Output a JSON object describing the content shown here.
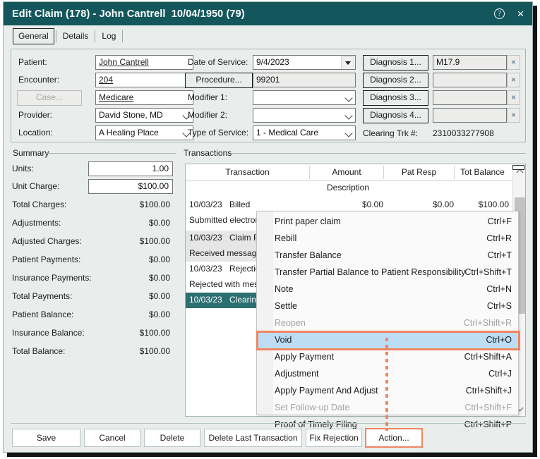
{
  "window": {
    "title": "Edit Claim (178) - John Cantrell  10/04/1950 (79)",
    "help_icon": "?",
    "close_icon": "×",
    "titlebar_color": "#13565c",
    "accent_color": "#f08562",
    "selection_color": "#2c6f70"
  },
  "tabs": [
    {
      "label": "General",
      "active": true
    },
    {
      "label": "Details",
      "active": false
    },
    {
      "label": "Log",
      "active": false
    }
  ],
  "form": {
    "left": {
      "patient_label": "Patient:",
      "patient_value": "John Cantrell",
      "encounter_label": "Encounter:",
      "encounter_value": "204",
      "case_button": "Case...",
      "case_value": "Medicare",
      "provider_label": "Provider:",
      "provider_value": "David Stone, MD",
      "location_label": "Location:",
      "location_value": "A Healing Place"
    },
    "middle": {
      "date_of_service_label": "Date of Service:",
      "date_of_service_value": "9/4/2023",
      "procedure_button": "Procedure...",
      "procedure_value": "99201",
      "modifier1_label": "Modifier 1:",
      "modifier1_value": "",
      "modifier2_label": "Modifier 2:",
      "modifier2_value": "",
      "type_of_service_label": "Type of Service:",
      "type_of_service_value": "1 - Medical Care"
    },
    "right": {
      "diagnosis_rows": [
        {
          "button": "Diagnosis 1...",
          "value": "M17.9",
          "clear": "×"
        },
        {
          "button": "Diagnosis 2...",
          "value": "",
          "clear": "×"
        },
        {
          "button": "Diagnosis 3...",
          "value": "",
          "clear": "×"
        },
        {
          "button": "Diagnosis 4...",
          "value": "",
          "clear": "×"
        }
      ],
      "clearing_label": "Clearing Trk #:",
      "clearing_value": "2310033277908"
    }
  },
  "summary": {
    "group_label": "Summary",
    "units_label": "Units:",
    "units_value": "1.00",
    "unit_charge_label": "Unit Charge:",
    "unit_charge_value": "$100.00",
    "rows": [
      {
        "label": "Total Charges:",
        "value": "$100.00"
      },
      {
        "label": "Adjustments:",
        "value": "$0.00"
      },
      {
        "label": "Adjusted Charges:",
        "value": "$100.00"
      },
      {
        "label": "Patient Payments:",
        "value": "$0.00"
      },
      {
        "label": "Insurance Payments:",
        "value": "$0.00"
      },
      {
        "label": "Total Payments:",
        "value": "$0.00"
      },
      {
        "label": "Patient Balance:",
        "value": "$0.00"
      },
      {
        "label": "Insurance Balance:",
        "value": "$100.00"
      },
      {
        "label": "Total Balance:",
        "value": "$100.00"
      }
    ]
  },
  "transactions": {
    "group_label": "Transactions",
    "columns": [
      "Transaction",
      "Amount",
      "Pat Resp",
      "Tot Balance"
    ],
    "description_header": "Description",
    "rows": [
      {
        "date": "10/03/23",
        "name": "Billed",
        "amount": "$0.00",
        "pat_resp": "$0.00",
        "tot_balance": "$100.00",
        "description": "Submitted electronically",
        "state": "normal"
      },
      {
        "date": "10/03/23",
        "name": "Claim Processing",
        "amount": "",
        "pat_resp": "",
        "tot_balance": "",
        "description": "Received messages",
        "state": "alt"
      },
      {
        "date": "10/03/23",
        "name": "Rejection",
        "amount": "",
        "pat_resp": "",
        "tot_balance": "",
        "description": "Rejected with messages",
        "state": "normal"
      },
      {
        "date": "10/03/23",
        "name": "Clearinghouse",
        "amount": "",
        "pat_resp": "",
        "tot_balance": "",
        "description": "",
        "state": "selected"
      }
    ]
  },
  "context_menu": {
    "items": [
      {
        "label": "Print paper claim",
        "shortcut": "Ctrl+F",
        "state": "normal"
      },
      {
        "label": "Rebill",
        "shortcut": "Ctrl+R",
        "state": "normal"
      },
      {
        "label": "Transfer Balance",
        "shortcut": "Ctrl+T",
        "state": "normal"
      },
      {
        "label": "Transfer Partial Balance to Patient Responsibility",
        "shortcut": "Ctrl+Shift+T",
        "state": "normal"
      },
      {
        "label": "Note",
        "shortcut": "Ctrl+N",
        "state": "normal"
      },
      {
        "label": "Settle",
        "shortcut": "Ctrl+S",
        "state": "normal"
      },
      {
        "label": "Reopen",
        "shortcut": "Ctrl+Shift+R",
        "state": "disabled"
      },
      {
        "label": "Void",
        "shortcut": "Ctrl+O",
        "state": "highlighted"
      },
      {
        "label": "Apply Payment",
        "shortcut": "Ctrl+Shift+A",
        "state": "normal"
      },
      {
        "label": "Adjustment",
        "shortcut": "Ctrl+J",
        "state": "normal"
      },
      {
        "label": "Apply Payment And Adjust",
        "shortcut": "Ctrl+Shift+J",
        "state": "normal"
      },
      {
        "label": "Set Follow-up Date",
        "shortcut": "Ctrl+Shift+F",
        "state": "disabled"
      },
      {
        "label": "Proof of Timely Filing",
        "shortcut": "Ctrl+Shift+P",
        "state": "normal"
      }
    ]
  },
  "footer": {
    "buttons": [
      {
        "label": "Save",
        "highlighted": false
      },
      {
        "label": "Cancel",
        "highlighted": false
      },
      {
        "label": "Delete",
        "highlighted": false
      },
      {
        "label": "Delete Last Transaction",
        "highlighted": false
      },
      {
        "label": "Fix Rejection",
        "highlighted": false
      },
      {
        "label": "Action...",
        "highlighted": true
      }
    ]
  }
}
